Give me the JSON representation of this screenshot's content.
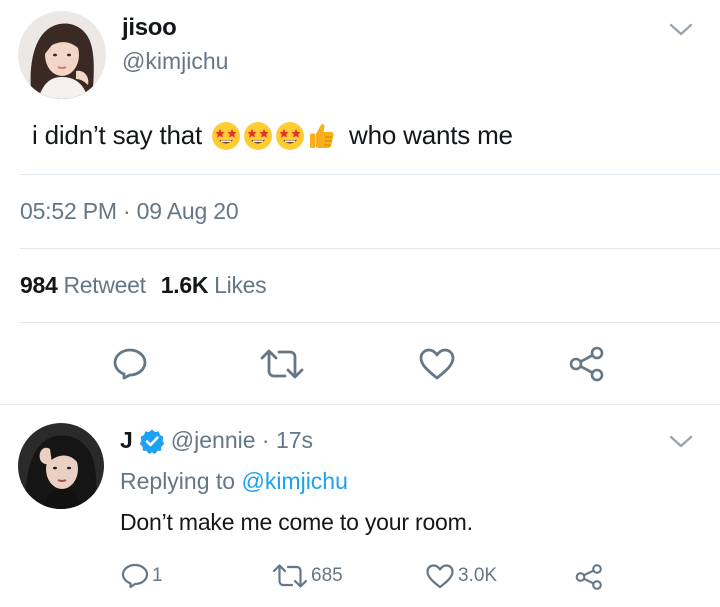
{
  "main_tweet": {
    "display_name": "jisoo",
    "handle": "@kimjichu",
    "text_before": "i didn’t say that",
    "emojis": [
      "star-struck-emoji",
      "star-struck-emoji",
      "star-struck-emoji",
      "thumbs-up-emoji"
    ],
    "text_after": "who wants me",
    "timestamp": "05:52 PM · 09 Aug 20",
    "retweet_count": "984",
    "retweet_label": "Retweet",
    "like_count": "1.6K",
    "like_label": "Likes",
    "actions": [
      "reply-icon",
      "retweet-icon",
      "like-icon",
      "share-icon"
    ]
  },
  "reply_tweet": {
    "display_name": "J",
    "verified": true,
    "handle_time": "@jennie · 17s",
    "replying_prefix": "Replying to",
    "replying_to": "@kimjichu",
    "text": "Don’t make me come to your room.",
    "reply_count": "1",
    "retweet_count": "685",
    "like_count": "3.0K"
  },
  "colors": {
    "link": "#1da1f2",
    "muted": "#657786",
    "text": "#14171a",
    "divider": "#e1e8ed",
    "icon": "#657786"
  }
}
